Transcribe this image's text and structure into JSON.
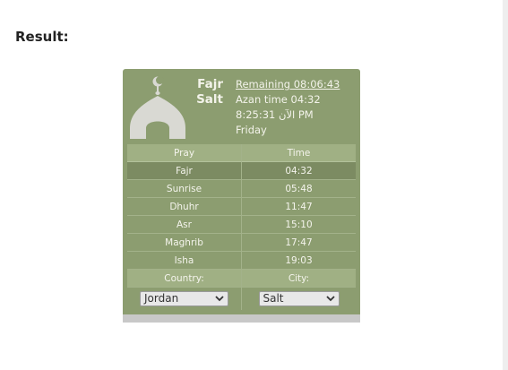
{
  "page": {
    "heading": "Result:"
  },
  "widget": {
    "prayer_name": "Fajr",
    "city_name": "Salt",
    "remaining": "Remaining 08:06:43",
    "azan_time": "Azan time 04:32",
    "current_time": "8:25:31 الآن PM",
    "day": "Friday",
    "icons": {
      "mosque": "mosque-icon",
      "dropdown": "chevron-down-icon"
    },
    "colors": {
      "panel": "#8c9d70",
      "header_row": "#a0b084",
      "active_row": "#7c8b62",
      "text": "#f3f3ea"
    },
    "table": {
      "headers": [
        "Pray",
        "Time"
      ],
      "rows": [
        {
          "name": "Fajr",
          "time": "04:32",
          "active": true
        },
        {
          "name": "Sunrise",
          "time": "05:48",
          "active": false
        },
        {
          "name": "Dhuhr",
          "time": "11:47",
          "active": false
        },
        {
          "name": "Asr",
          "time": "15:10",
          "active": false
        },
        {
          "name": "Maghrib",
          "time": "17:47",
          "active": false
        },
        {
          "name": "Isha",
          "time": "19:03",
          "active": false
        }
      ]
    },
    "country_label": "Country:",
    "city_label": "City:",
    "country_value": "Jordan",
    "city_value": "Salt"
  }
}
